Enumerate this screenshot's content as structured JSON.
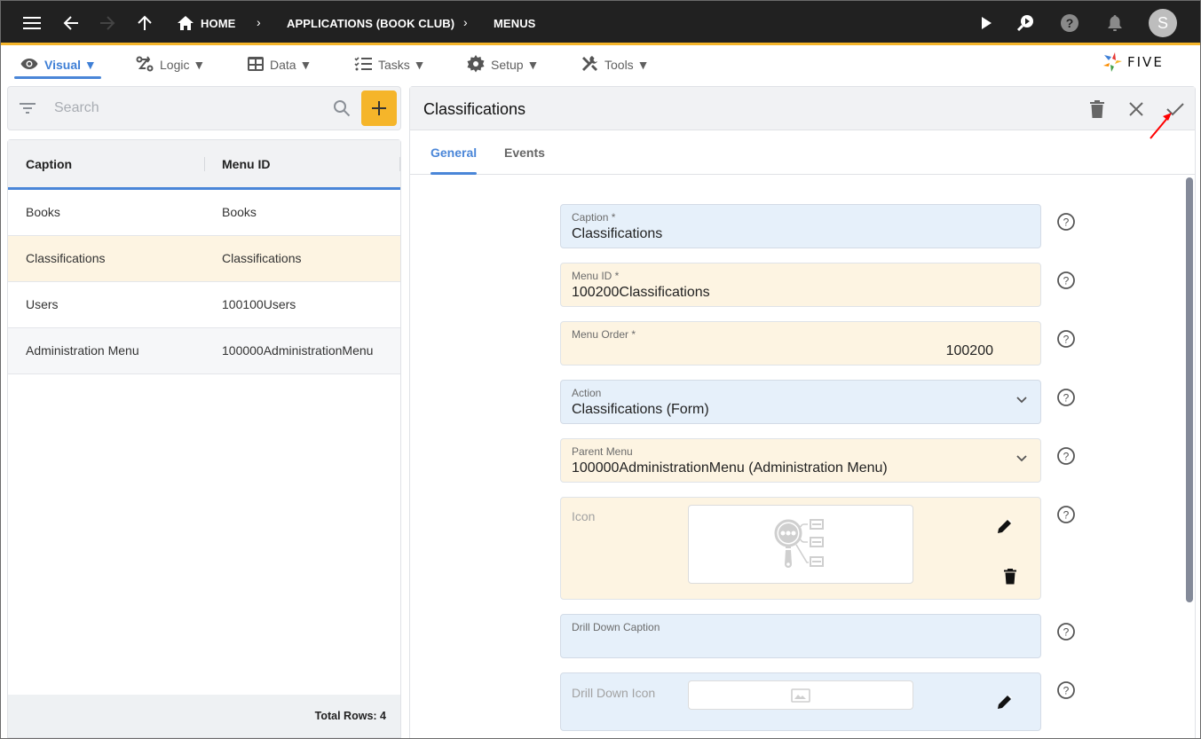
{
  "topbar": {
    "breadcrumbs": [
      "HOME",
      "APPLICATIONS (BOOK CLUB)",
      "MENUS"
    ],
    "avatar_initial": "S",
    "icons": [
      "menu-icon",
      "back-arrow-icon",
      "forward-arrow-icon",
      "up-arrow-icon",
      "home-icon",
      "play-icon",
      "search-play-icon",
      "help-icon",
      "bell-icon"
    ]
  },
  "menubar": {
    "items": [
      {
        "label": "Visual ▼",
        "icon": "eye-icon",
        "active": true
      },
      {
        "label": "Logic ▼",
        "icon": "logic-icon"
      },
      {
        "label": "Data ▼",
        "icon": "table-icon"
      },
      {
        "label": "Tasks ▼",
        "icon": "checklist-icon"
      },
      {
        "label": "Setup ▼",
        "icon": "gear-icon"
      },
      {
        "label": "Tools ▼",
        "icon": "tools-icon"
      }
    ],
    "logo_text": "FIVE"
  },
  "list": {
    "search_placeholder": "Search",
    "columns": [
      "Caption",
      "Menu ID"
    ],
    "rows": [
      {
        "caption": "Books",
        "menu_id": "Books"
      },
      {
        "caption": "Classifications",
        "menu_id": "Classifications",
        "selected": true
      },
      {
        "caption": "Users",
        "menu_id": "100100Users"
      },
      {
        "caption": "Administration Menu",
        "menu_id": "100000AdministrationMenu"
      }
    ],
    "total_rows_label": "Total Rows: 4"
  },
  "form": {
    "title": "Classifications",
    "tabs": [
      {
        "label": "General",
        "active": true
      },
      {
        "label": "Events"
      }
    ],
    "fields": {
      "caption": {
        "label": "Caption *",
        "value": "Classifications"
      },
      "menu_id": {
        "label": "Menu ID *",
        "value": "100200Classifications"
      },
      "menu_order": {
        "label": "Menu Order *",
        "value": "100200"
      },
      "action": {
        "label": "Action",
        "value": "Classifications (Form)"
      },
      "parent_menu": {
        "label": "Parent Menu",
        "value": "100000AdministrationMenu (Administration Menu)"
      },
      "icon": {
        "label": "Icon"
      },
      "drill_down_caption": {
        "label": "Drill Down Caption",
        "value": ""
      },
      "drill_down_icon": {
        "label": "Drill Down Icon"
      }
    },
    "scroll": {
      "visible_fraction": 0.76,
      "position": 0
    }
  },
  "colors": {
    "topbar_bg": "#212121",
    "accent_yellow": "#f5b52a",
    "accent_blue": "#4a86d8",
    "field_blue": "#e6f0fa",
    "field_yellow": "#fdf4e2",
    "annotation_red": "#ff0000"
  }
}
